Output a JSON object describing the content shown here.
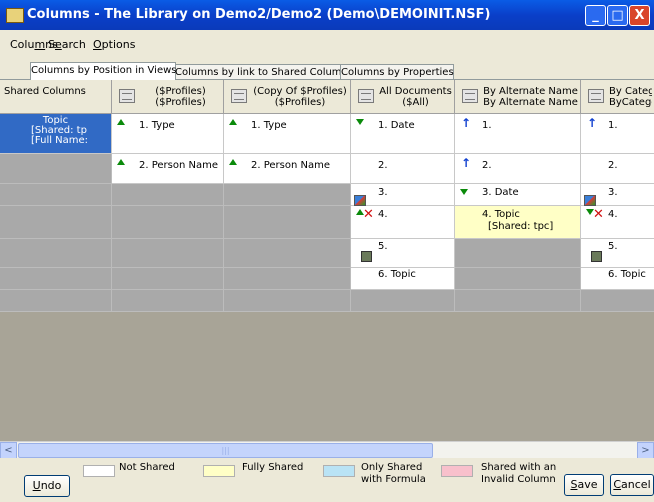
{
  "window": {
    "title": "Columns - The Library on Demo2/Demo2 (Demo\\DEMOINIT.NSF)",
    "minimize": "_",
    "maximize": "□",
    "close": "X"
  },
  "menu": {
    "columns": {
      "pre": "Colu",
      "acc": "m",
      "post": "ns"
    },
    "search": {
      "pre": "S",
      "acc": "e",
      "post": "arch"
    },
    "options": {
      "pre": "",
      "acc": "O",
      "post": "ptions"
    }
  },
  "tabs": [
    {
      "label": "Columns by Position in Views",
      "active": true
    },
    {
      "label": "Columns by link to Shared Columns",
      "active": false
    },
    {
      "label": "Columns by Properties",
      "active": false
    }
  ],
  "grid": {
    "shared_header": "Shared Columns",
    "shared_cell": {
      "title": "Topic",
      "line2": "[Shared: tp",
      "line3": "[Full Name:"
    },
    "views": [
      {
        "name": "($Profiles)",
        "alias": "($Profiles)"
      },
      {
        "name": "(Copy Of $Profiles)",
        "alias": "($Profiles)"
      },
      {
        "name": "All Documents",
        "alias": "($All)"
      },
      {
        "name": "By Alternate Name",
        "alias": "By Alternate Name"
      },
      {
        "name": "By Catego",
        "alias": "ByCatego"
      }
    ],
    "cells": {
      "v1_r1": "1. Type",
      "v1_r2": "2. Person Name",
      "v2_r1": "1. Type",
      "v2_r2": "2. Person Name",
      "v3_r1": "1. Date",
      "v3_r2": "2.",
      "v3_r3": "3.",
      "v3_r4": "4.",
      "v3_r5": "5.",
      "v3_r6": "6. Topic",
      "v4_r1": "1.",
      "v4_r2": "2.",
      "v4_r3": "3. Date",
      "v4_r4a": "4. Topic",
      "v4_r4b": "[Shared: tpc]",
      "v5_r1": "1.",
      "v5_r2": "2.",
      "v5_r3": "3.",
      "v5_r4": "4.",
      "v5_r5": "5.",
      "v5_r6": "6. Topic"
    }
  },
  "scrollbar": {
    "left": "<",
    "right": ">",
    "grip": "|||"
  },
  "legend": {
    "undo": {
      "pre": "",
      "acc": "U",
      "post": "ndo"
    },
    "not_shared": "Not Shared",
    "fully_shared": "Fully Shared",
    "only_shared_1": "Only Shared",
    "only_shared_2": "with Formula",
    "invalid_1": "Shared with an",
    "invalid_2": "Invalid Column",
    "save": {
      "pre": "",
      "acc": "S",
      "post": "ave"
    },
    "cancel": {
      "pre": "",
      "acc": "C",
      "post": "ancel"
    },
    "colors": {
      "not_shared": "#ffffff",
      "fully_shared": "#ffffc6",
      "only_formula": "#b9e3f5",
      "invalid": "#f8c0cc"
    }
  }
}
